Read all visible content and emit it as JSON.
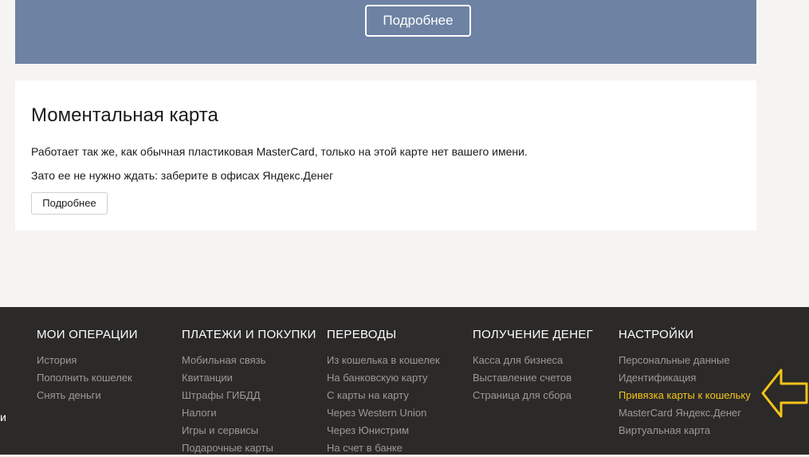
{
  "promo": {
    "button_label": "Подробнее"
  },
  "card": {
    "title": "Моментальная карта",
    "line1": "Работает так же, как обычная пластиковая MasterCard, только на этой карте нет вашего имени.",
    "line2": "Зато ее не нужно ждать: заберите в офисах Яндекс.Денег",
    "button_label": "Подробнее"
  },
  "footer": {
    "left_edge_text": "и",
    "columns": [
      {
        "title": "МОИ ОПЕРАЦИИ",
        "links": [
          "История",
          "Пополнить кошелек",
          "Снять деньги"
        ]
      },
      {
        "title": "ПЛАТЕЖИ И ПОКУПКИ",
        "links": [
          "Мобильная связь",
          "Квитанции",
          "Штрафы ГИБДД",
          "Налоги",
          "Игры и сервисы",
          "Подарочные карты"
        ]
      },
      {
        "title": "ПЕРЕВОДЫ",
        "links": [
          "Из кошелька в кошелек",
          "На банковскую карту",
          "С карты на карту",
          "Через Western Union",
          "Через Юнистрим",
          "На счет в банке"
        ]
      },
      {
        "title": "ПОЛУЧЕНИЕ ДЕНЕГ",
        "links": [
          "Касса для бизнеса",
          "Выставление счетов",
          "Страница для сбора"
        ]
      },
      {
        "title": "НАСТРОЙКИ",
        "links": [
          "Персональные данные",
          "Идентификация",
          "Привязка карты к кошельку",
          "MasterCard Яндекс.Денег",
          "Виртуальная карта"
        ]
      }
    ]
  },
  "colors": {
    "accent": "#f6c419",
    "banner": "#6e82a3",
    "footer_bg": "#2b2a29"
  },
  "annotation": {
    "icon": "arrow-left-icon"
  }
}
